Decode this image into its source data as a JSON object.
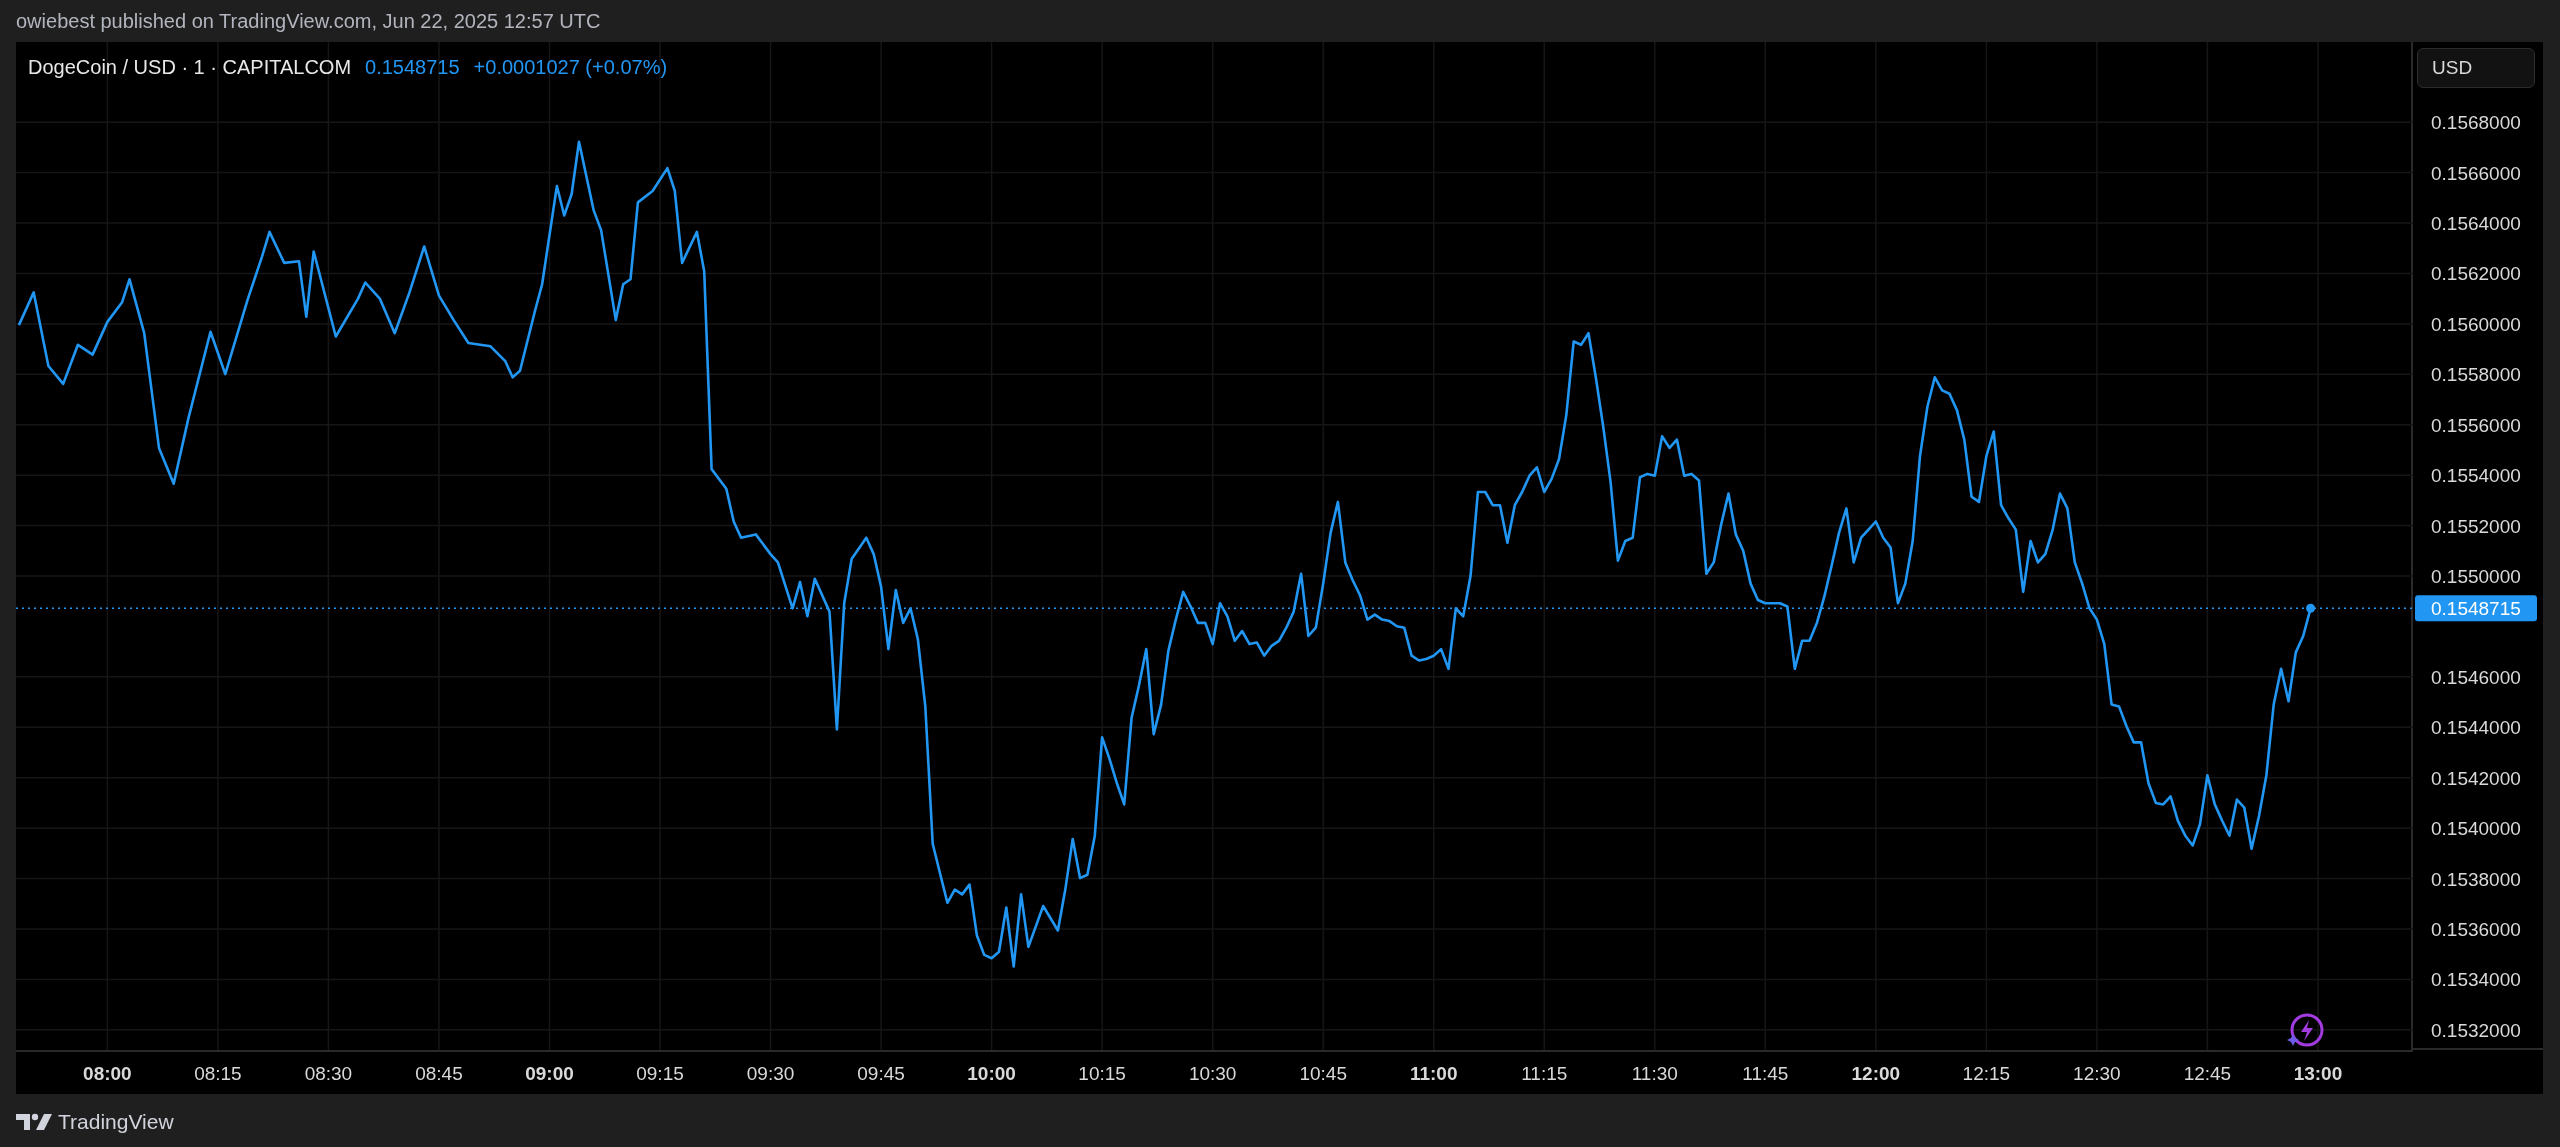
{
  "header": {
    "publisher_line": "owiebest published on TradingView.com, Jun 22, 2025 12:57 UTC"
  },
  "chart": {
    "symbol": "DogeCoin / USD · 1 · CAPITALCOM",
    "last_price": "0.1548715",
    "change": "+0.0001027 (+0.07%)",
    "currency_button": "USD",
    "current_price_label": "0.1548715",
    "chart_data": {
      "type": "line",
      "grid": true,
      "ref_lines": [
        {
          "axis": "y",
          "value": 0.154872
        }
      ],
      "xlim": [
        467.6,
        792.9
      ],
      "ylim": [
        0.15312,
        0.157118
      ],
      "xticks": [
        {
          "value": 480,
          "label": "08:00"
        },
        {
          "value": 495,
          "label": "08:15"
        },
        {
          "value": 510,
          "label": "08:30"
        },
        {
          "value": 525,
          "label": "08:45"
        },
        {
          "value": 540,
          "label": "09:00"
        },
        {
          "value": 555,
          "label": "09:15"
        },
        {
          "value": 570,
          "label": "09:30"
        },
        {
          "value": 585,
          "label": "09:45"
        },
        {
          "value": 600,
          "label": "10:00"
        },
        {
          "value": 615,
          "label": "10:15"
        },
        {
          "value": 630,
          "label": "10:30"
        },
        {
          "value": 645,
          "label": "10:45"
        },
        {
          "value": 660,
          "label": "11:00"
        },
        {
          "value": 675,
          "label": "11:15"
        },
        {
          "value": 690,
          "label": "11:30"
        },
        {
          "value": 705,
          "label": "11:45"
        },
        {
          "value": 720,
          "label": "12:00"
        },
        {
          "value": 735,
          "label": "12:15"
        },
        {
          "value": 750,
          "label": "12:30"
        },
        {
          "value": 765,
          "label": "12:45"
        },
        {
          "value": 780,
          "label": "13:00"
        }
      ],
      "yticks": [
        {
          "value": 0.1532,
          "label": "0.1532000"
        },
        {
          "value": 0.1534,
          "label": "0.1534000"
        },
        {
          "value": 0.1536,
          "label": "0.1536000"
        },
        {
          "value": 0.1538,
          "label": "0.1538000"
        },
        {
          "value": 0.154,
          "label": "0.1540000"
        },
        {
          "value": 0.1542,
          "label": "0.1542000"
        },
        {
          "value": 0.1544,
          "label": "0.1544000"
        },
        {
          "value": 0.1546,
          "label": "0.1546000"
        },
        {
          "value": 0.155,
          "label": "0.1550000"
        },
        {
          "value": 0.1552,
          "label": "0.1552000"
        },
        {
          "value": 0.1554,
          "label": "0.1554000"
        },
        {
          "value": 0.1556,
          "label": "0.1556000"
        },
        {
          "value": 0.1558,
          "label": "0.1558000"
        },
        {
          "value": 0.156,
          "label": "0.1560000"
        },
        {
          "value": 0.1562,
          "label": "0.1562000"
        },
        {
          "value": 0.1564,
          "label": "0.1564000"
        },
        {
          "value": 0.1566,
          "label": "0.1566000"
        },
        {
          "value": 0.1568,
          "label": "0.1568000"
        }
      ],
      "x": [
        468,
        470,
        472,
        474,
        476,
        478,
        480,
        482,
        483,
        485,
        487,
        489,
        491,
        494,
        496,
        499,
        501,
        502,
        504,
        506,
        507,
        508,
        511,
        514,
        515,
        517,
        519,
        521,
        523,
        525,
        527,
        529,
        532,
        534,
        535,
        536,
        538,
        539,
        541,
        542,
        543,
        544,
        546,
        547,
        549,
        550,
        551,
        552,
        554,
        556,
        557,
        558,
        560,
        561,
        562,
        564,
        565,
        566,
        568,
        570,
        571,
        573,
        574,
        575,
        576,
        578,
        579,
        580,
        581,
        583,
        584,
        585,
        586,
        587,
        588,
        589,
        590,
        591,
        592,
        593,
        594,
        595,
        596,
        597,
        598,
        599,
        600,
        601,
        602,
        603,
        604,
        605,
        607,
        609,
        610,
        611,
        612,
        613,
        614,
        615,
        616,
        617,
        618,
        619,
        620,
        621,
        622,
        623,
        624,
        625,
        626,
        627,
        628,
        629,
        630,
        631,
        632,
        633,
        634,
        635,
        636,
        637,
        638,
        639,
        640,
        641,
        642,
        643,
        644,
        645,
        646,
        647,
        648,
        649,
        650,
        651,
        652,
        653,
        654,
        655,
        656,
        657,
        658,
        659,
        660,
        661,
        662,
        663,
        664,
        665,
        666,
        667,
        668,
        669,
        670,
        671,
        672,
        673,
        674,
        675,
        676,
        677,
        678,
        679,
        680,
        681,
        682,
        683,
        684,
        685,
        686,
        687,
        688,
        689,
        690,
        691,
        692,
        693,
        694,
        695,
        696,
        697,
        698,
        699,
        700,
        701,
        702,
        703,
        704,
        705,
        706,
        707,
        708,
        709,
        710,
        711,
        712,
        713,
        714,
        715,
        716,
        717,
        718,
        719,
        720,
        721,
        722,
        723,
        724,
        725,
        726,
        727,
        728,
        729,
        730,
        731,
        732,
        733,
        734,
        735,
        736,
        737,
        738,
        739,
        740,
        741,
        742,
        743,
        744,
        745,
        746,
        747,
        748,
        749,
        750,
        751,
        752,
        753,
        754,
        755,
        756,
        757,
        758,
        759,
        760,
        761,
        762,
        763,
        764,
        765,
        766,
        767,
        768,
        769,
        770,
        771,
        772,
        773,
        774,
        775,
        776,
        777,
        778,
        779
      ],
      "series": [
        {
          "color": "#2196f3",
          "values": [
            0.155995,
            0.156125,
            0.155833,
            0.155762,
            0.155917,
            0.155878,
            0.156008,
            0.156086,
            0.156177,
            0.155963,
            0.155508,
            0.155366,
            0.155625,
            0.155969,
            0.155801,
            0.156093,
            0.156268,
            0.156365,
            0.156242,
            0.156248,
            0.156028,
            0.156287,
            0.15595,
            0.156099,
            0.156164,
            0.156099,
            0.155963,
            0.156125,
            0.156307,
            0.156112,
            0.156015,
            0.155924,
            0.155911,
            0.155852,
            0.155788,
            0.155814,
            0.156047,
            0.156157,
            0.156547,
            0.15643,
            0.156514,
            0.156722,
            0.15645,
            0.156372,
            0.156015,
            0.156157,
            0.156177,
            0.156482,
            0.156527,
            0.156618,
            0.156527,
            0.156242,
            0.156365,
            0.156209,
            0.155424,
            0.155346,
            0.155216,
            0.155152,
            0.155165,
            0.155087,
            0.155054,
            0.154872,
            0.154976,
            0.15484,
            0.154989,
            0.154859,
            0.154392,
            0.154892,
            0.155067,
            0.155152,
            0.155087,
            0.154957,
            0.15471,
            0.154944,
            0.154814,
            0.154872,
            0.154749,
            0.154483,
            0.153938,
            0.153821,
            0.153704,
            0.153756,
            0.153737,
            0.153776,
            0.153574,
            0.153497,
            0.153484,
            0.15351,
            0.153685,
            0.153451,
            0.153737,
            0.153529,
            0.153691,
            0.153594,
            0.153756,
            0.153957,
            0.153802,
            0.153815,
            0.15397,
            0.15436,
            0.154275,
            0.154178,
            0.154094,
            0.154438,
            0.154567,
            0.15471,
            0.154373,
            0.15449,
            0.154704,
            0.154827,
            0.154937,
            0.154879,
            0.154814,
            0.154814,
            0.15473,
            0.154892,
            0.15484,
            0.154743,
            0.154782,
            0.15473,
            0.154736,
            0.154684,
            0.154723,
            0.154743,
            0.154795,
            0.154859,
            0.155009,
            0.154762,
            0.154795,
            0.15497,
            0.155171,
            0.155294,
            0.155054,
            0.154983,
            0.154924,
            0.154827,
            0.154847,
            0.154827,
            0.154821,
            0.154801,
            0.154795,
            0.154684,
            0.154665,
            0.154671,
            0.154684,
            0.15471,
            0.154632,
            0.154872,
            0.15484,
            0.155002,
            0.155333,
            0.155333,
            0.155281,
            0.155281,
            0.155132,
            0.155281,
            0.155333,
            0.155398,
            0.155431,
            0.155333,
            0.155385,
            0.155463,
            0.155638,
            0.15593,
            0.155917,
            0.155963,
            0.155788,
            0.155593,
            0.155372,
            0.155061,
            0.155139,
            0.155152,
            0.155392,
            0.155405,
            0.155398,
            0.155554,
            0.155508,
            0.155541,
            0.155398,
            0.155405,
            0.155379,
            0.155009,
            0.155054,
            0.155203,
            0.155327,
            0.155165,
            0.1551,
            0.15497,
            0.154905,
            0.154892,
            0.154892,
            0.154892,
            0.154879,
            0.154632,
            0.154743,
            0.154743,
            0.154814,
            0.154918,
            0.155041,
            0.155171,
            0.155268,
            0.155054,
            0.155152,
            0.155184,
            0.155216,
            0.155152,
            0.155113,
            0.154892,
            0.15497,
            0.155139,
            0.155476,
            0.155671,
            0.155788,
            0.155736,
            0.155723,
            0.155658,
            0.155541,
            0.155314,
            0.155294,
            0.155476,
            0.155573,
            0.155281,
            0.155229,
            0.155184,
            0.154937,
            0.155139,
            0.155054,
            0.155087,
            0.155184,
            0.155327,
            0.155268,
            0.155054,
            0.15497,
            0.154872,
            0.154827,
            0.15473,
            0.15449,
            0.154483,
            0.154405,
            0.15434,
            0.15434,
            0.154178,
            0.1541,
            0.154094,
            0.154126,
            0.154029,
            0.15397,
            0.153931,
            0.154016,
            0.15421,
            0.154094,
            0.154029,
            0.15397,
            0.154113,
            0.154081,
            0.153918,
            0.154048,
            0.15421,
            0.15449,
            0.154632,
            0.154503,
            0.154697,
            0.154762,
            0.154872
          ]
        }
      ]
    }
  },
  "footer": {
    "brand": "TradingView"
  }
}
